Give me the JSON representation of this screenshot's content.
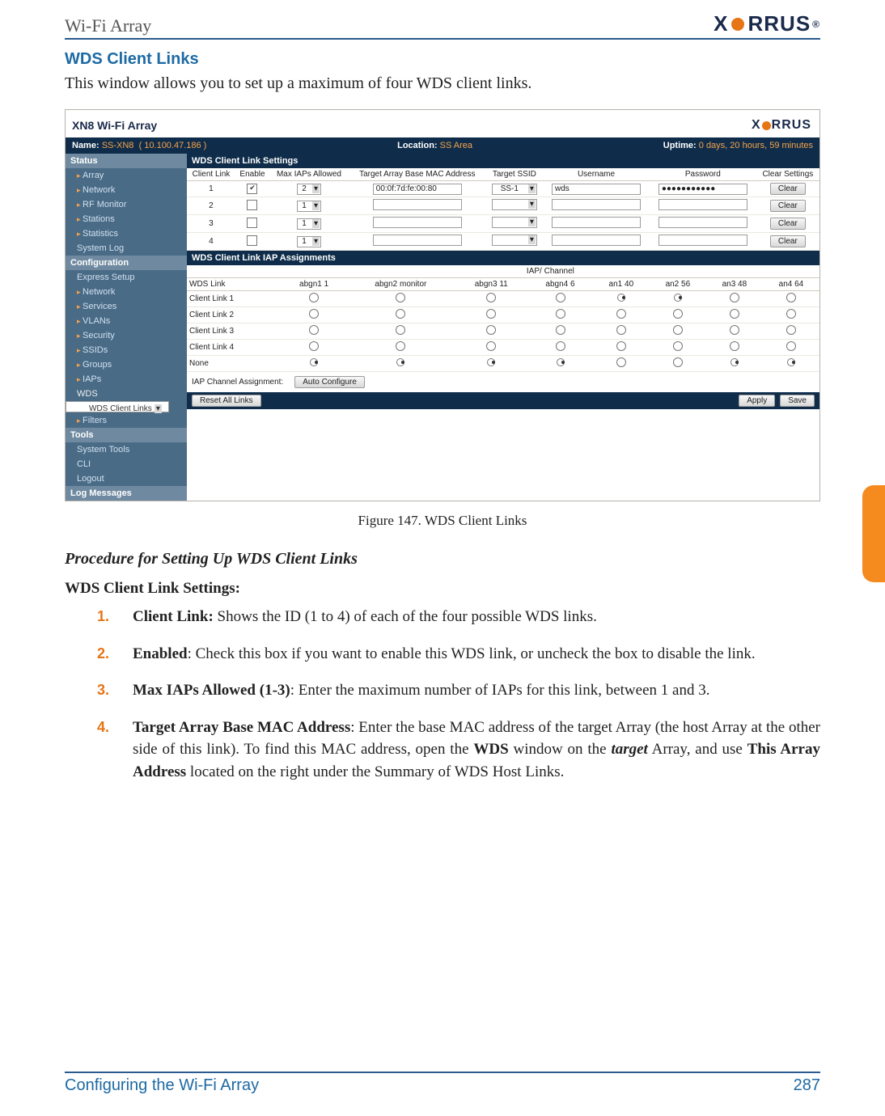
{
  "header": {
    "title": "Wi-Fi Array",
    "brand": "XIRRUS"
  },
  "section_title": "WDS Client Links",
  "intro": "This window allows you to set up a maximum of four WDS client links.",
  "shot": {
    "window_title": "XN8 Wi-Fi Array",
    "name_label": "Name:",
    "name_value": "SS-XN8",
    "name_ip": "( 10.100.47.186 )",
    "loc_label": "Location:",
    "loc_value": "SS Area",
    "up_label": "Uptime:",
    "up_value": "0 days, 20 hours, 59 minutes",
    "side": {
      "status": "Status",
      "status_items": [
        "Array",
        "Network",
        "RF Monitor",
        "Stations",
        "Statistics",
        "System Log"
      ],
      "config": "Configuration",
      "config_items": [
        "Express Setup",
        "Network",
        "Services",
        "VLANs",
        "Security",
        "SSIDs",
        "Groups",
        "IAPs",
        "WDS"
      ],
      "wds_child": "WDS Client Links",
      "filters": "Filters",
      "tools": "Tools",
      "tools_items": [
        "System Tools",
        "CLI",
        "Logout"
      ],
      "log": "Log Messages"
    },
    "settings_hdr": "WDS Client Link Settings",
    "cols": {
      "c1": "Client Link",
      "c2": "Enable",
      "c3": "Max IAPs Allowed",
      "c4": "Target Array Base MAC Address",
      "c5": "Target SSID",
      "c6": "Username",
      "c7": "Password",
      "c8": "Clear Settings"
    },
    "rows": [
      {
        "id": "1",
        "en": true,
        "max": "2",
        "mac": "00:0f:7d:fe:00:80",
        "ssid": "SS-1",
        "user": "wds",
        "pass": "●●●●●●●●●●●",
        "clear": "Clear"
      },
      {
        "id": "2",
        "en": false,
        "max": "1",
        "mac": "",
        "ssid": "",
        "user": "",
        "pass": "",
        "clear": "Clear"
      },
      {
        "id": "3",
        "en": false,
        "max": "1",
        "mac": "",
        "ssid": "",
        "user": "",
        "pass": "",
        "clear": "Clear"
      },
      {
        "id": "4",
        "en": false,
        "max": "1",
        "mac": "",
        "ssid": "",
        "user": "",
        "pass": "",
        "clear": "Clear"
      }
    ],
    "assign_hdr": "WDS Client Link IAP Assignments",
    "iap_super": "IAP/ Channel",
    "iap_cols": [
      "WDS Link",
      "abgn1 1",
      "abgn2 monitor",
      "abgn3 11",
      "abgn4 6",
      "an1 40",
      "an2 56",
      "an3 48",
      "an4 64"
    ],
    "iap_rows": [
      {
        "n": "Client Link 1",
        "sel": [
          false,
          false,
          false,
          false,
          true,
          true,
          false,
          false
        ]
      },
      {
        "n": "Client Link 2",
        "sel": [
          false,
          false,
          false,
          false,
          false,
          false,
          false,
          false
        ]
      },
      {
        "n": "Client Link 3",
        "sel": [
          false,
          false,
          false,
          false,
          false,
          false,
          false,
          false
        ]
      },
      {
        "n": "Client Link 4",
        "sel": [
          false,
          false,
          false,
          false,
          false,
          false,
          false,
          false
        ]
      },
      {
        "n": "None",
        "sel": [
          true,
          true,
          true,
          true,
          false,
          false,
          true,
          true
        ]
      }
    ],
    "iap_assign_lbl": "IAP Channel Assignment:",
    "auto_cfg": "Auto Configure",
    "reset": "Reset All Links",
    "apply": "Apply",
    "save": "Save"
  },
  "figure_caption": "Figure 147. WDS Client Links",
  "procedure_heading": "Procedure for Setting Up WDS Client Links",
  "settings_heading": "WDS Client Link Settings:",
  "steps": [
    {
      "lead": "Client Link:",
      "rest": " Shows the ID (1 to 4) of each of the four possible WDS links."
    },
    {
      "lead": "Enabled",
      "rest": ": Check this box if you want to enable this WDS link, or uncheck the box to disable the link."
    },
    {
      "lead": "Max IAPs Allowed (1-3)",
      "rest": ": Enter the maximum number of IAPs for this link, between 1 and 3."
    },
    {
      "lead": "Target Array Base MAC Address",
      "rest_html": true,
      "parts": {
        "p0": ": Enter the base MAC address of the target Array (the host Array at the other side of this link). To find this MAC address, open the ",
        "p1": "WDS",
        "p2": " window on the ",
        "p3": "target",
        "p4": " Array, and use ",
        "p5": "This Array Address",
        "p6": " located on the right under the Summary of WDS Host Links."
      }
    }
  ],
  "footer": {
    "left": "Configuring the Wi-Fi Array",
    "right": "287"
  }
}
